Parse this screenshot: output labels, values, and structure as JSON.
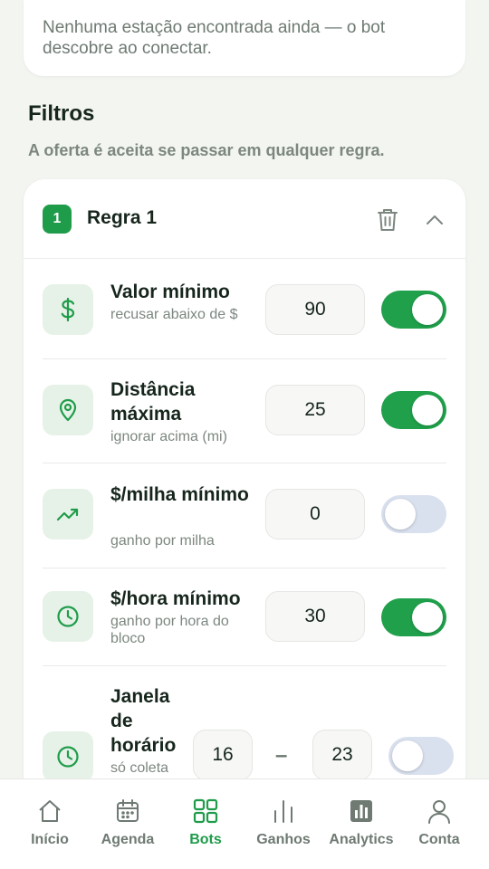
{
  "notice": {
    "text": "Nenhuma estação encontrada ainda — o bot descobre ao conectar."
  },
  "filters": {
    "title": "Filtros",
    "subtitle": "A oferta é aceita se passar em qualquer regra."
  },
  "rule": {
    "number": "1",
    "title": "Regra 1",
    "icons": {
      "delete": "trash-icon",
      "collapse": "chevron-up-icon"
    },
    "rows": [
      {
        "title": "Valor mínimo",
        "subtitle": "recusar abaixo de $",
        "value": "90",
        "enabled": true,
        "icon": "dollar-icon"
      },
      {
        "title": "Distância máxima",
        "subtitle": "ignorar acima (mi)",
        "value": "25",
        "enabled": true,
        "icon": "map-pin-icon"
      },
      {
        "title": "$/milha mínimo",
        "subtitle": "ganho por milha",
        "value": "0",
        "enabled": false,
        "icon": "trending-up-icon"
      },
      {
        "title": "$/hora mínimo",
        "subtitle": "ganho por hora do bloco",
        "value": "30",
        "enabled": true,
        "icon": "clock-icon"
      },
      {
        "title": "Janela de horário",
        "subtitle": "só coleta",
        "value_from": "16",
        "separator": "–",
        "value_to": "23",
        "enabled": false,
        "icon": "clock-icon"
      }
    ]
  },
  "nav": {
    "active": "Bots",
    "items": [
      {
        "label": "Início",
        "icon": "home-icon"
      },
      {
        "label": "Agenda",
        "icon": "calendar-icon"
      },
      {
        "label": "Bots",
        "icon": "grid-icon"
      },
      {
        "label": "Ganhos",
        "icon": "bar-chart-icon"
      },
      {
        "label": "Analytics",
        "icon": "analytics-icon"
      },
      {
        "label": "Conta",
        "icon": "user-icon"
      }
    ]
  },
  "colors": {
    "accent": "#1f9c4a",
    "toggle_on": "#20a04b",
    "toggle_off": "#d9e0ee",
    "icon_bg": "#e6f2e8",
    "background": "#f3f5f1"
  }
}
